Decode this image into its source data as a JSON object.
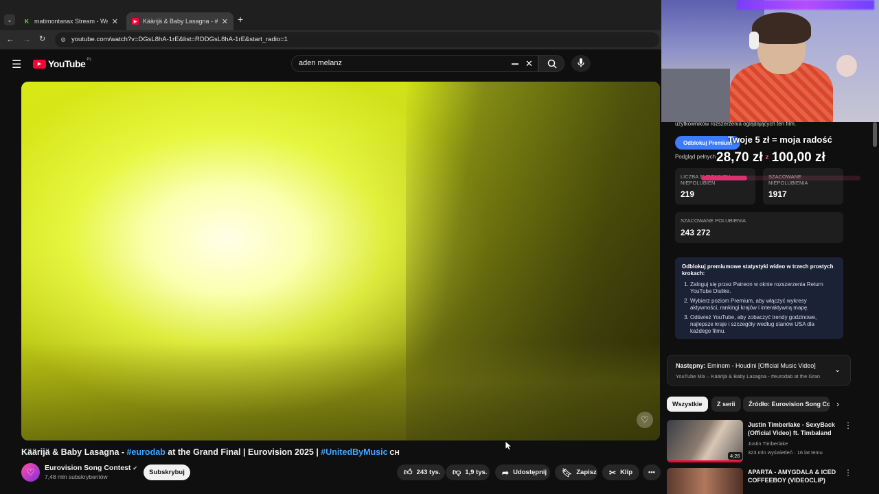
{
  "browser": {
    "tabs": [
      {
        "title": "matimontanax Stream - Watch",
        "icon": "kick-icon",
        "color": "#53fc18"
      },
      {
        "title": "Käärijä & Baby Lasagna - #eurod",
        "icon": "youtube-icon",
        "color": "#ff0033"
      }
    ],
    "new_tab": "+",
    "url": "youtube.com/watch?v=DGsL8hA-1rE&list=RDDGsL8hA-1rE&start_radio=1"
  },
  "youtube": {
    "logo_text": "YouTube",
    "region": "PL",
    "search_value": "aden melanz"
  },
  "video": {
    "title_parts": {
      "a": "Käärijä & Baby Lasagna - ",
      "tag1": "#eurodab",
      "b": " at the Grand Final | Eurovision 2025 | ",
      "tag2": "#UnitedByMusic",
      "c": " CH"
    },
    "channel": "Eurovision Song Contest",
    "subscribers": "7,48 mln subskrybentów",
    "subscribe_label": "Subskrybuj",
    "likes": "243 tys.",
    "dislikes": "1,9 tys.",
    "share": "Udostępnij",
    "save": "Zapisz",
    "clip": "Klip"
  },
  "donation": {
    "line1": "Twoje 5 zł = moja radość",
    "amount": "28,70 zł",
    "separator": "z",
    "goal": "100,00 zł"
  },
  "rpanel": {
    "top_text": "użytkowników rozszerzenia oglądających ten film.",
    "premium_button": "Odblokuj Premium",
    "preview_text": "Podgląd pełnych",
    "stats": {
      "raw_dislikes_label": "LICZBA SUROWYCH NIEPOLUBIEŃ",
      "raw_dislikes_value": "219",
      "est_dislikes_label": "SZACOWANE NIEPOLUBIENIA",
      "est_dislikes_value": "1917",
      "est_likes_label": "SZACOWANE POLUBIENIA",
      "est_likes_value": "243 272"
    },
    "unlock_heading": "Odblokuj premiumowe statystyki wideo w trzech prostych krokach:",
    "steps": [
      "Zaloguj się przez Patreon w oknie rozszerzenia Return YouTube Dislike.",
      "Wybierz poziom Premium, aby włączyć wykresy aktywności, rankingi krajów i interaktywną mapę.",
      "Odśwież YouTube, aby zobaczyć trendy godzinowe, najlepsze kraje i szczegóły według stanów USA dla każdego filmu."
    ],
    "next_label": "Następny:",
    "next_title": "Eminem - Houdini [Official Music Video]",
    "next_sub": "YouTube Mix – Käärijä & Baby Lasagna - #eurodab at the Gran",
    "chips": [
      "Wszystkie",
      "Z serii",
      "Źródło: Eurovision Song Co"
    ],
    "recs": [
      {
        "title": "Justin Timberlake - SexyBack (Official Video) ft. Timbaland",
        "channel": "Justin Timberlake",
        "meta": "323 mln wyświetleń · 16 lat temu",
        "duration": "4:26"
      },
      {
        "title": "APARTA - AMYGDALA & ICED COFFEEBOY (VIDEOCLIP)",
        "channel": "",
        "meta": "",
        "duration": ""
      }
    ]
  }
}
